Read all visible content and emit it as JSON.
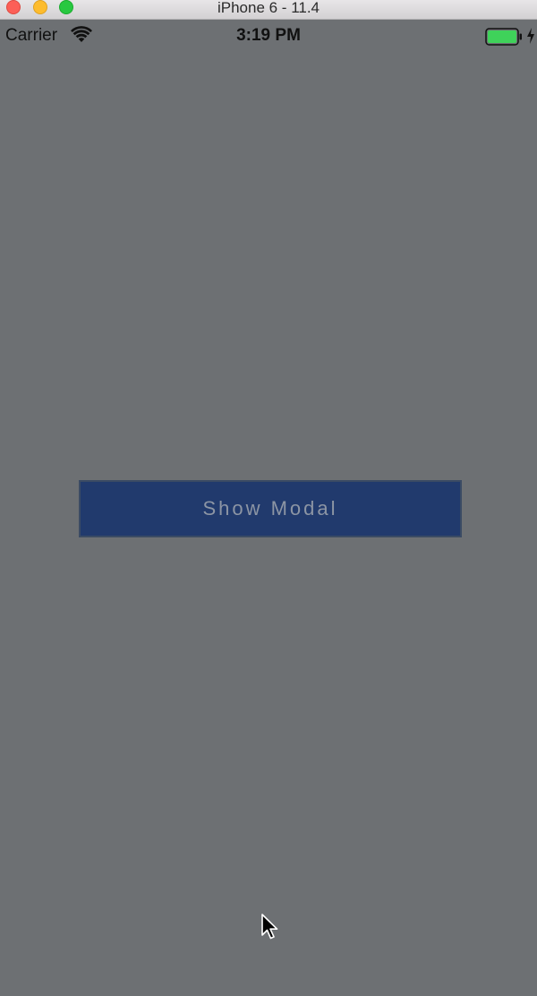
{
  "window": {
    "title": "iPhone 6 - 11.4"
  },
  "status_bar": {
    "carrier": "Carrier",
    "time": "3:19 PM",
    "battery_color": "#3fd25a"
  },
  "main": {
    "button_label": "Show Modal",
    "button_color": "#213a6d"
  },
  "icons": [
    "close-icon",
    "minimize-icon",
    "maximize-icon",
    "wifi-icon",
    "battery-icon",
    "charging-icon",
    "mouse-cursor-icon"
  ]
}
